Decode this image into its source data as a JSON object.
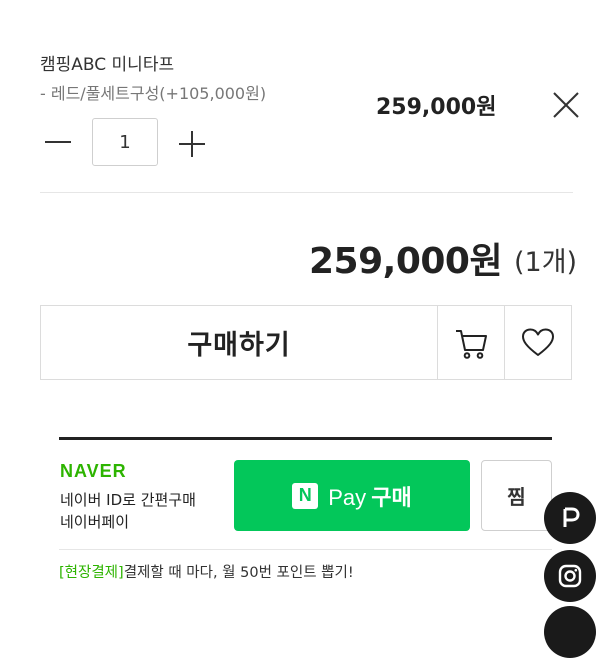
{
  "product": {
    "name": "캠핑ABC 미니타프",
    "option": "- 레드/풀세트구성(+105,000원)",
    "price": "259,000원",
    "quantity": "1"
  },
  "total": {
    "price": "259,000원",
    "count": "(1개)"
  },
  "actions": {
    "buy_label": "구매하기"
  },
  "naver": {
    "logo": "NAVER",
    "desc_line1": "네이버 ID로 간편구매",
    "desc_line2": "네이버페이",
    "npay_n": "N",
    "npay_pay": "Pay",
    "npay_buy": "구매",
    "zzim_label": "찜",
    "promo_tag": "[현장결제]",
    "promo_text": "결제할 때 마다, 월 50번 포인트 뽑기!",
    "brand_color": "#03c75a"
  },
  "icons": {
    "remove": "close-icon",
    "minus": "minus-icon",
    "plus": "plus-icon",
    "cart": "cart-icon",
    "wish": "heart-icon",
    "floating": [
      "pay-icon",
      "instagram-icon",
      "floating-icon"
    ]
  }
}
